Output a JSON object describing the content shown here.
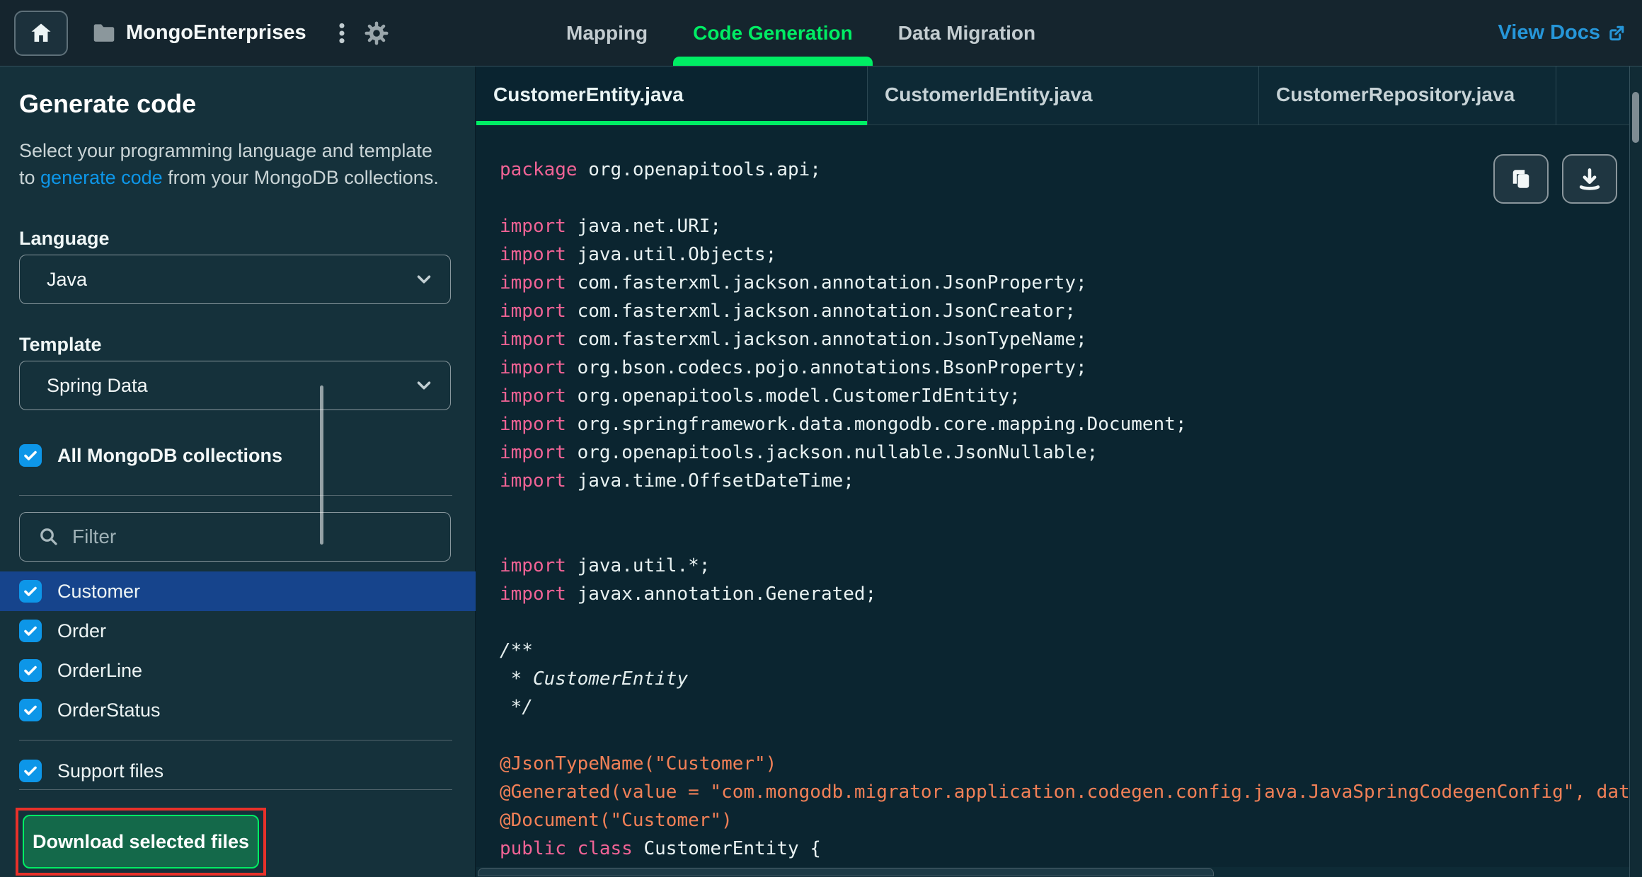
{
  "header": {
    "project_name": "MongoEnterprises",
    "nav_tabs": [
      {
        "label": "Mapping",
        "active": false
      },
      {
        "label": "Code Generation",
        "active": true
      },
      {
        "label": "Data Migration",
        "active": false
      }
    ],
    "view_docs_label": "View Docs"
  },
  "sidebar": {
    "title": "Generate code",
    "description_line1": "Select your programming language and template",
    "description_line2_pre": "to ",
    "description_link": "generate code",
    "description_line2_post": " from your MongoDB collections.",
    "language_label": "Language",
    "language_value": "Java",
    "template_label": "Template",
    "template_value": "Spring Data",
    "all_collections_label": "All MongoDB collections",
    "filter_placeholder": "Filter",
    "collections": [
      {
        "name": "Customer",
        "checked": true,
        "selected": true
      },
      {
        "name": "Order",
        "checked": true,
        "selected": false
      },
      {
        "name": "OrderLine",
        "checked": true,
        "selected": false
      },
      {
        "name": "OrderStatus",
        "checked": true,
        "selected": false
      }
    ],
    "support_files_label": "Support files",
    "download_button_label": "Download selected files"
  },
  "editor": {
    "file_tabs": [
      {
        "label": "CustomerEntity.java",
        "active": true
      },
      {
        "label": "CustomerIdEntity.java",
        "active": false
      },
      {
        "label": "CustomerRepository.java",
        "active": false
      }
    ],
    "code_lines": [
      [
        {
          "c": "kw",
          "t": "package"
        },
        {
          "c": "pl",
          "t": " org.openapitools.api;"
        }
      ],
      [],
      [
        {
          "c": "kw",
          "t": "import"
        },
        {
          "c": "pl",
          "t": " java.net.URI;"
        }
      ],
      [
        {
          "c": "kw",
          "t": "import"
        },
        {
          "c": "pl",
          "t": " java.util.Objects;"
        }
      ],
      [
        {
          "c": "kw",
          "t": "import"
        },
        {
          "c": "pl",
          "t": " com.fasterxml.jackson.annotation.JsonProperty;"
        }
      ],
      [
        {
          "c": "kw",
          "t": "import"
        },
        {
          "c": "pl",
          "t": " com.fasterxml.jackson.annotation.JsonCreator;"
        }
      ],
      [
        {
          "c": "kw",
          "t": "import"
        },
        {
          "c": "pl",
          "t": " com.fasterxml.jackson.annotation.JsonTypeName;"
        }
      ],
      [
        {
          "c": "kw",
          "t": "import"
        },
        {
          "c": "pl",
          "t": " org.bson.codecs.pojo.annotations.BsonProperty;"
        }
      ],
      [
        {
          "c": "kw",
          "t": "import"
        },
        {
          "c": "pl",
          "t": " org.openapitools.model.CustomerIdEntity;"
        }
      ],
      [
        {
          "c": "kw",
          "t": "import"
        },
        {
          "c": "pl",
          "t": " org.springframework.data.mongodb.core.mapping.Document;"
        }
      ],
      [
        {
          "c": "kw",
          "t": "import"
        },
        {
          "c": "pl",
          "t": " org.openapitools.jackson.nullable.JsonNullable;"
        }
      ],
      [
        {
          "c": "kw",
          "t": "import"
        },
        {
          "c": "pl",
          "t": " java.time.OffsetDateTime;"
        }
      ],
      [],
      [],
      [
        {
          "c": "kw",
          "t": "import"
        },
        {
          "c": "pl",
          "t": " java.util.*;"
        }
      ],
      [
        {
          "c": "kw",
          "t": "import"
        },
        {
          "c": "pl",
          "t": " javax.annotation.Generated;"
        }
      ],
      [],
      [
        {
          "c": "cm",
          "t": "/**"
        }
      ],
      [
        {
          "c": "cm",
          "t": " * CustomerEntity"
        }
      ],
      [
        {
          "c": "cm",
          "t": " */"
        }
      ],
      [],
      [
        {
          "c": "an",
          "t": "@JsonTypeName(\"Customer\")"
        }
      ],
      [
        {
          "c": "an",
          "t": "@Generated(value = \"com.mongodb.migrator.application.codegen.config.java.JavaSpringCodegenConfig\", dat"
        }
      ],
      [
        {
          "c": "an",
          "t": "@Document(\"Customer\")"
        }
      ],
      [
        {
          "c": "kw",
          "t": "public class"
        },
        {
          "c": "pl",
          "t": " CustomerEntity {"
        }
      ]
    ]
  },
  "colors": {
    "accent_green": "#00ED64",
    "link_blue": "#0D96E8",
    "view_docs_blue": "#2696D8",
    "checkbox_blue": "#0D96E8",
    "selected_row_blue": "#16448C",
    "keyword_pink": "#F06395",
    "annotation_orange": "#F28057",
    "annotation_box_red": "#E8312A",
    "download_button_green": "#14694A"
  }
}
